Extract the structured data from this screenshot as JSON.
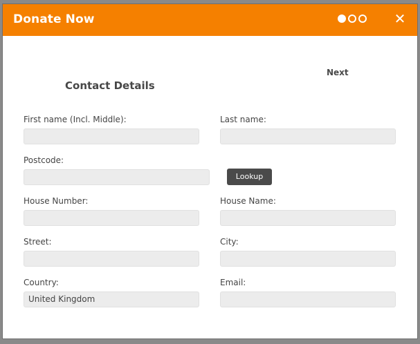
{
  "header": {
    "title": "Donate Now",
    "close_glyph": "✕",
    "steps": [
      "active",
      "inactive",
      "inactive"
    ]
  },
  "nav": {
    "next_label": "Next"
  },
  "form": {
    "section_title": "Contact Details",
    "first_name": {
      "label": "First name (Incl. Middle):",
      "value": ""
    },
    "last_name": {
      "label": "Last name:",
      "value": ""
    },
    "postcode": {
      "label": "Postcode:",
      "value": ""
    },
    "lookup_label": "Lookup",
    "house_number": {
      "label": "House Number:",
      "value": ""
    },
    "house_name": {
      "label": "House Name:",
      "value": ""
    },
    "street": {
      "label": "Street:",
      "value": ""
    },
    "city": {
      "label": "City:",
      "value": ""
    },
    "country": {
      "label": "Country:",
      "value": "United Kingdom"
    },
    "email": {
      "label": "Email:",
      "value": ""
    }
  },
  "colors": {
    "accent": "#f58000",
    "field_bg": "#ececec",
    "button_bg": "#4a4a4a"
  },
  "icons": {
    "close": "close-icon",
    "step": "step-indicator-dot"
  }
}
